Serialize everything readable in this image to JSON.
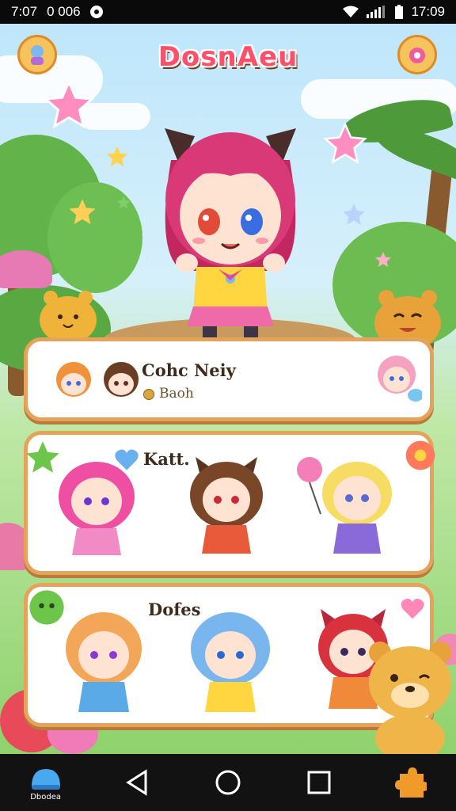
{
  "status_bar": {
    "time_left": "7:07",
    "indicator_left": "0 006",
    "time_right": "17:09"
  },
  "header": {
    "logo_text": "DosnAeu"
  },
  "panels": [
    {
      "title": "Cohc Neiy",
      "subtitle": "Baoh"
    },
    {
      "title": "Katt."
    },
    {
      "title": "Dofes"
    }
  ],
  "nav": {
    "home_label": "Dbodea"
  },
  "colors": {
    "panel_border": "#e5a35a",
    "logo": "#ff4f6a",
    "nav_bg": "#121212"
  }
}
